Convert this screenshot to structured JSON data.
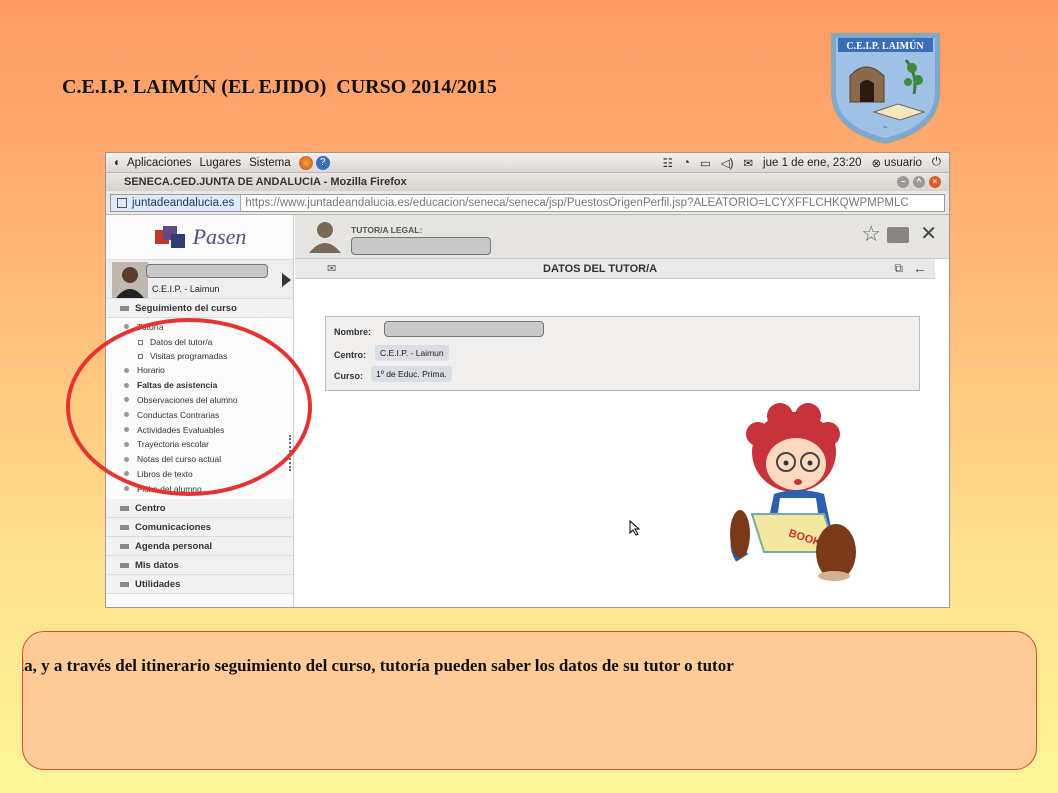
{
  "slide": {
    "title": "C.E.I.P. LAIMÚN (EL EJIDO)  CURSO 2014/2015",
    "logo_text": "C.E.I.P. LAIMÚN",
    "caption": "quierda, y a través del itinerario seguimiento del curso, tutoría pueden saber los datos de su tutor o tutor"
  },
  "os_bar": {
    "menus": [
      "Aplicaciones",
      "Lugares",
      "Sistema"
    ],
    "datetime": "jue  1 de ene, 23:20",
    "user": "usuario"
  },
  "window": {
    "title": "SENECA.CED.JUNTA DE ANDALUCIA - Mozilla Firefox",
    "site": "juntadeandalucia.es",
    "url": "https://www.juntadeandalucia.es/educacion/seneca/seneca/jsp/PuestosOrigenPerfil.jsp?ALEATORIO=LCYXFFLCHKQWPMPMLC"
  },
  "app": {
    "logo": "Pasen",
    "user_school": "C.E.I.P. - Laimun",
    "tutor_label": "TUTOR/A LEGAL:",
    "page_title": "DATOS DEL TUTOR/A"
  },
  "sidebar": {
    "section_seguimiento": "Seguimiento del curso",
    "tutoria": "Tutoría",
    "sub_items": [
      "Datos del tutor/a",
      "Visitas programadas"
    ],
    "items": [
      {
        "label": "Horario",
        "bold": false
      },
      {
        "label": "Faltas de asistencia",
        "bold": true
      },
      {
        "label": "Observaciones del alumno",
        "bold": false
      },
      {
        "label": "Conductas Contrarias",
        "bold": false
      },
      {
        "label": "Actividades Evaluables",
        "bold": false
      },
      {
        "label": "Trayectoria escolar",
        "bold": false
      },
      {
        "label": "Notas del curso actual",
        "bold": false
      },
      {
        "label": "Libros de texto",
        "bold": false
      },
      {
        "label": "Ficha del alumno",
        "bold": false
      }
    ],
    "sections": [
      "Centro",
      "Comunicaciones",
      "Agenda personal",
      "Mis datos",
      "Utilidades"
    ]
  },
  "form": {
    "nombre_label": "Nombre:",
    "centro_label": "Centro:",
    "centro_value": "C.E.I.P. - Laimun",
    "curso_label": "Curso:",
    "curso_value": "1º de Educ. Prima."
  },
  "colors": {
    "accent_circle": "#e53232",
    "caption_bg": "#ffcc99"
  }
}
